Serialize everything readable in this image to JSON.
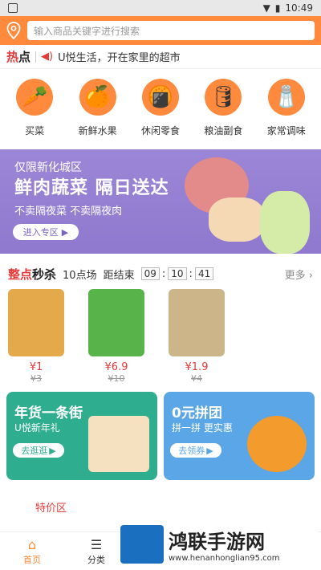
{
  "status_bar": {
    "time": "10:49"
  },
  "search": {
    "placeholder": "输入商品关键字进行搜索"
  },
  "notice": {
    "tag_red": "热",
    "tag_black": "点",
    "text": "U悦生活，开在家里的超市"
  },
  "categories": [
    {
      "label": "买菜",
      "icon": "vegetable-icon",
      "glyph": "🥕"
    },
    {
      "label": "新鲜水果",
      "icon": "fruit-icon",
      "glyph": "🍊"
    },
    {
      "label": "休闲零食",
      "icon": "snack-icon",
      "glyph": "🍘"
    },
    {
      "label": "粮油副食",
      "icon": "oil-icon",
      "glyph": "🛢"
    },
    {
      "label": "家常调味",
      "icon": "seasoning-icon",
      "glyph": "🧂"
    }
  ],
  "banner": {
    "top": "仅限新化城区",
    "headline": "鲜肉蔬菜  隔日送达",
    "sub": "不卖隔夜菜 不卖隔夜肉",
    "button": "进入专区"
  },
  "flash_sale": {
    "title_red": "整点",
    "title_black": "秒杀",
    "session": "10点场",
    "ends_label": "距结束",
    "hh": "09",
    "mm": "10",
    "ss": "41",
    "more": "更多",
    "items": [
      {
        "price": "¥1",
        "orig": "¥3",
        "color": "#e3a94a"
      },
      {
        "price": "¥6.9",
        "orig": "¥10",
        "color": "#58b34a"
      },
      {
        "price": "¥1.9",
        "orig": "¥4",
        "color": "#cdb58a"
      }
    ]
  },
  "promos": [
    {
      "title": "年货一条街",
      "sub": "U悦新年礼",
      "button": "去逛逛"
    },
    {
      "title": "0元拼团",
      "sub": "拼一拼 更实惠",
      "button": "去领券"
    }
  ],
  "section_title": "特价区",
  "tabs": [
    {
      "label": "首页",
      "icon": "home-icon",
      "glyph": "⌂"
    },
    {
      "label": "分类",
      "icon": "category-icon",
      "glyph": "☰"
    }
  ],
  "watermark": {
    "name": "鸿联手游网",
    "url": "www.henanhonglian95.com"
  }
}
